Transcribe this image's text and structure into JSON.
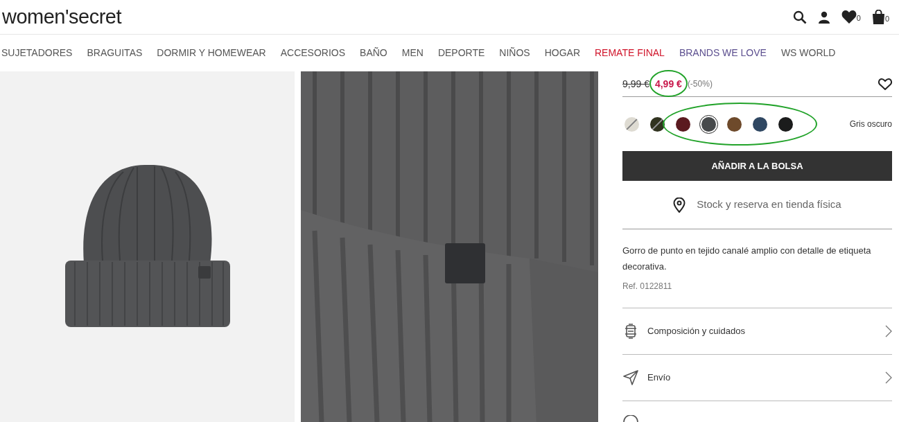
{
  "logo": "women'secret",
  "header_counts": {
    "wishlist": "0",
    "bag": "0"
  },
  "nav": [
    {
      "label": "SUJETADORES",
      "kind": "normal"
    },
    {
      "label": "BRAGUITAS",
      "kind": "normal"
    },
    {
      "label": "DORMIR Y HOMEWEAR",
      "kind": "normal"
    },
    {
      "label": "ACCESORIOS",
      "kind": "normal"
    },
    {
      "label": "BAÑO",
      "kind": "normal"
    },
    {
      "label": "MEN",
      "kind": "normal"
    },
    {
      "label": "DEPORTE",
      "kind": "normal"
    },
    {
      "label": "NIÑOS",
      "kind": "normal"
    },
    {
      "label": "HOGAR",
      "kind": "normal"
    },
    {
      "label": "REMATE FINAL",
      "kind": "sale"
    },
    {
      "label": "BRANDS WE LOVE",
      "kind": "brands"
    },
    {
      "label": "WS WORLD",
      "kind": "normal"
    }
  ],
  "product": {
    "old_price": "9,99 €",
    "price": "4,99 €",
    "discount": "(-50%)",
    "price_circled": true,
    "swatches_circled": true,
    "swatches": [
      {
        "color": "#dedbd2",
        "selected": false,
        "unavailable": true
      },
      {
        "color": "#30331f",
        "selected": false,
        "unavailable": true
      },
      {
        "color": "#5b1a20",
        "selected": false,
        "unavailable": false
      },
      {
        "color": "#474a4c",
        "selected": true,
        "unavailable": false
      },
      {
        "color": "#6e4a2b",
        "selected": false,
        "unavailable": false
      },
      {
        "color": "#2f4762",
        "selected": false,
        "unavailable": false
      },
      {
        "color": "#1b1c1c",
        "selected": false,
        "unavailable": false
      }
    ],
    "color_name": "Gris oscuro",
    "add_button": "AÑADIR A LA BOLSA",
    "store_link": "Stock y reserva en tienda física",
    "description": "Gorro de punto en tejido canalé amplio con detalle de etiqueta decorativa.",
    "ref": "Ref. 0122811",
    "sections": [
      {
        "kind": "care",
        "label": "Composición y cuidados"
      },
      {
        "kind": "shipping",
        "label": "Envío"
      },
      {
        "kind": "partial"
      }
    ]
  }
}
